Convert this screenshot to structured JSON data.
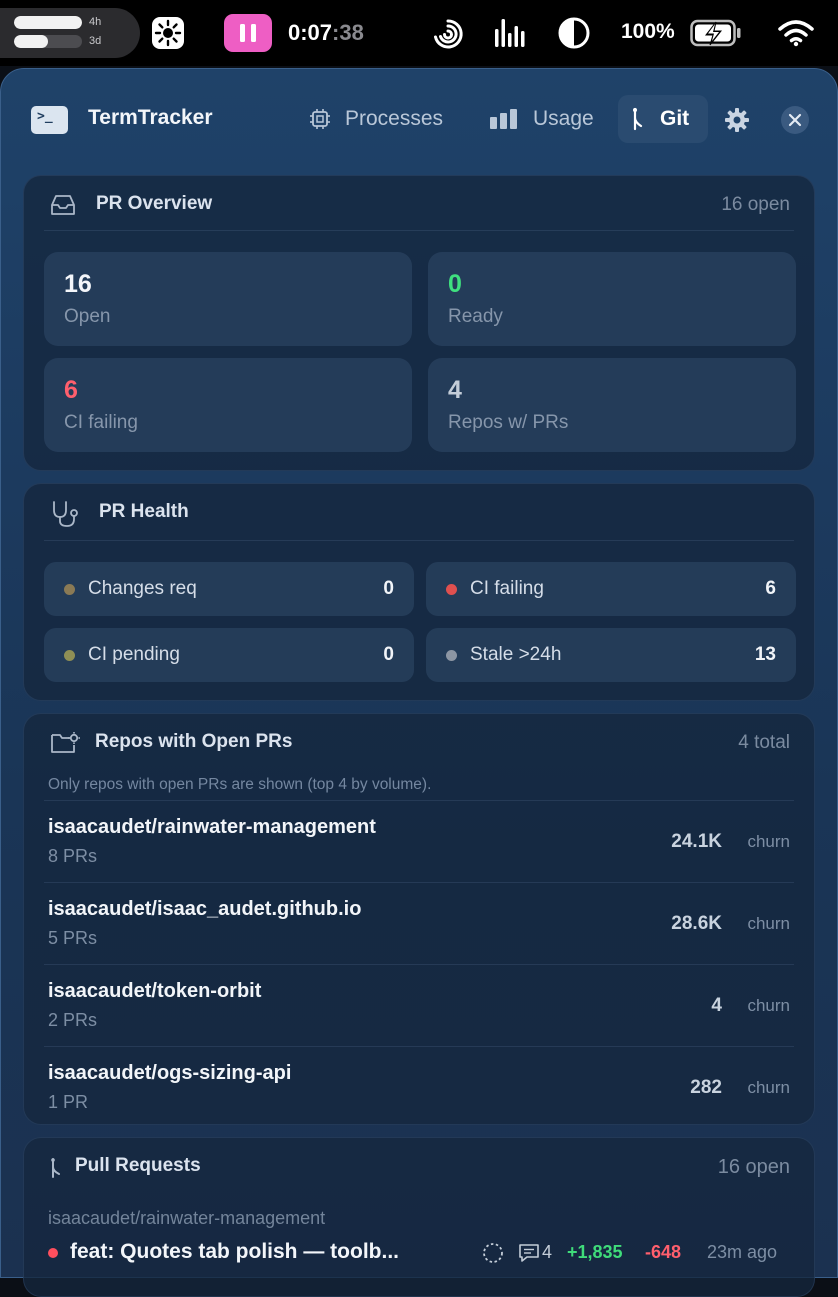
{
  "menubar": {
    "usage_bars": [
      {
        "label": "4h",
        "fill": 1.0
      },
      {
        "label": "3d",
        "fill": 0.5
      }
    ],
    "timer": {
      "main": "0:07",
      "seconds": ":38"
    },
    "battery": "100%",
    "icons": [
      "sun-widget-icon",
      "pause-icon",
      "swirl-icon",
      "equalizer-icon",
      "contrast-icon",
      "battery-charging-icon",
      "wifi-icon"
    ]
  },
  "header": {
    "title": "TermTracker",
    "tabs": [
      {
        "label": "Processes",
        "icon": "cpu-icon"
      },
      {
        "label": "Usage",
        "icon": "bar-chart-icon"
      },
      {
        "label": "Git",
        "icon": "git-branch-icon",
        "active": true
      }
    ]
  },
  "overview": {
    "title": "PR Overview",
    "meta": "16 open",
    "stats": [
      {
        "value": "16",
        "label": "Open",
        "color": "#f4f6fa"
      },
      {
        "value": "0",
        "label": "Ready",
        "color": "#3fe07f"
      },
      {
        "value": "6",
        "label": "CI failing",
        "color": "#ff5f6d"
      },
      {
        "value": "4",
        "label": "Repos w/ PRs",
        "color": "#c4cdd8"
      }
    ]
  },
  "health": {
    "title": "PR Health",
    "items": [
      {
        "label": "Changes req",
        "value": "0",
        "dot": "#8a7a55"
      },
      {
        "label": "CI failing",
        "value": "6",
        "dot": "#e0504f"
      },
      {
        "label": "CI pending",
        "value": "0",
        "dot": "#8f8f55"
      },
      {
        "label": "Stale >24h",
        "value": "13",
        "dot": "#8d96a3"
      }
    ]
  },
  "repos": {
    "title": "Repos with Open PRs",
    "meta": "4 total",
    "note": "Only repos with open PRs are shown (top 4 by volume).",
    "churn_label": "churn",
    "rows": [
      {
        "name": "isaacaudet/rainwater-management",
        "count": "8 PRs",
        "churn": "24.1K"
      },
      {
        "name": "isaacaudet/isaac_audet.github.io",
        "count": "5 PRs",
        "churn": "28.6K"
      },
      {
        "name": "isaacaudet/token-orbit",
        "count": "2 PRs",
        "churn": "4"
      },
      {
        "name": "isaacaudet/ogs-sizing-api",
        "count": "1 PR",
        "churn": "282"
      }
    ]
  },
  "pulls": {
    "title": "Pull Requests",
    "meta": "16 open",
    "group_repo": "isaacaudet/rainwater-management",
    "first": {
      "title": "feat: Quotes tab polish — toolb...",
      "comments": "4",
      "additions": "+1,835",
      "deletions": "-648",
      "age": "23m ago",
      "status_dot": "#ff4f5e"
    }
  }
}
